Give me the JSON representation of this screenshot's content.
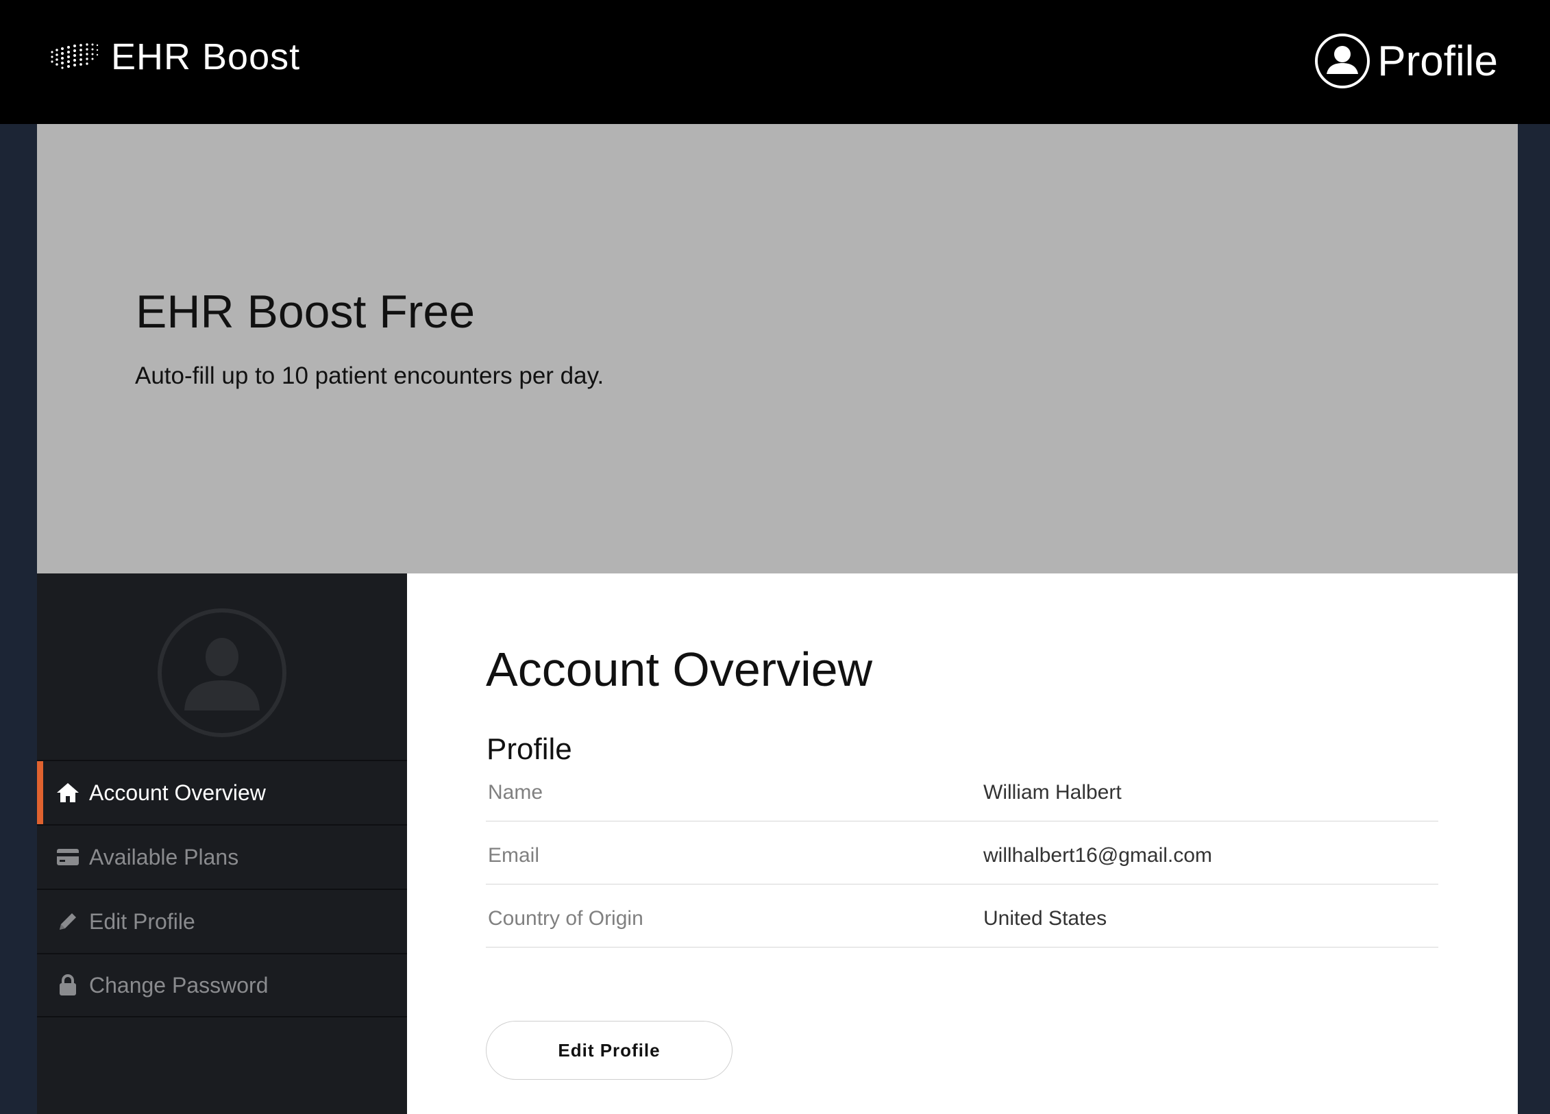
{
  "header": {
    "brand_name": "EHR Boost",
    "brand_logo_icon": "wave-grid-logo",
    "profile_label": "Profile",
    "profile_icon": "user-circle-icon"
  },
  "hero": {
    "plan_title": "EHR Boost Free",
    "plan_description": "Auto-fill up to 10 patient encounters per day."
  },
  "sidebar": {
    "avatar_icon": "user-circle-icon",
    "active_item": "Account Overview",
    "items": [
      {
        "label": "Account Overview",
        "icon": "home-icon"
      },
      {
        "label": "Available Plans",
        "icon": "credit-card-icon"
      },
      {
        "label": "Edit Profile",
        "icon": "pencil-icon"
      },
      {
        "label": "Change Password",
        "icon": "lock-icon"
      }
    ]
  },
  "main": {
    "title": "Account Overview",
    "section_title": "Profile",
    "profile_rows": [
      {
        "label": "Name",
        "value": "William Halbert"
      },
      {
        "label": "Email",
        "value": "willhalbert16@gmail.com"
      },
      {
        "label": "Country of Origin",
        "value": "United States"
      }
    ],
    "edit_button_label": "Edit Profile"
  },
  "colors": {
    "topbar": "#000000",
    "page_background": "#1c2535",
    "hero_background": "#b3b3b3",
    "sidebar_background": "#1a1c20",
    "active_accent": "#e0622f"
  }
}
